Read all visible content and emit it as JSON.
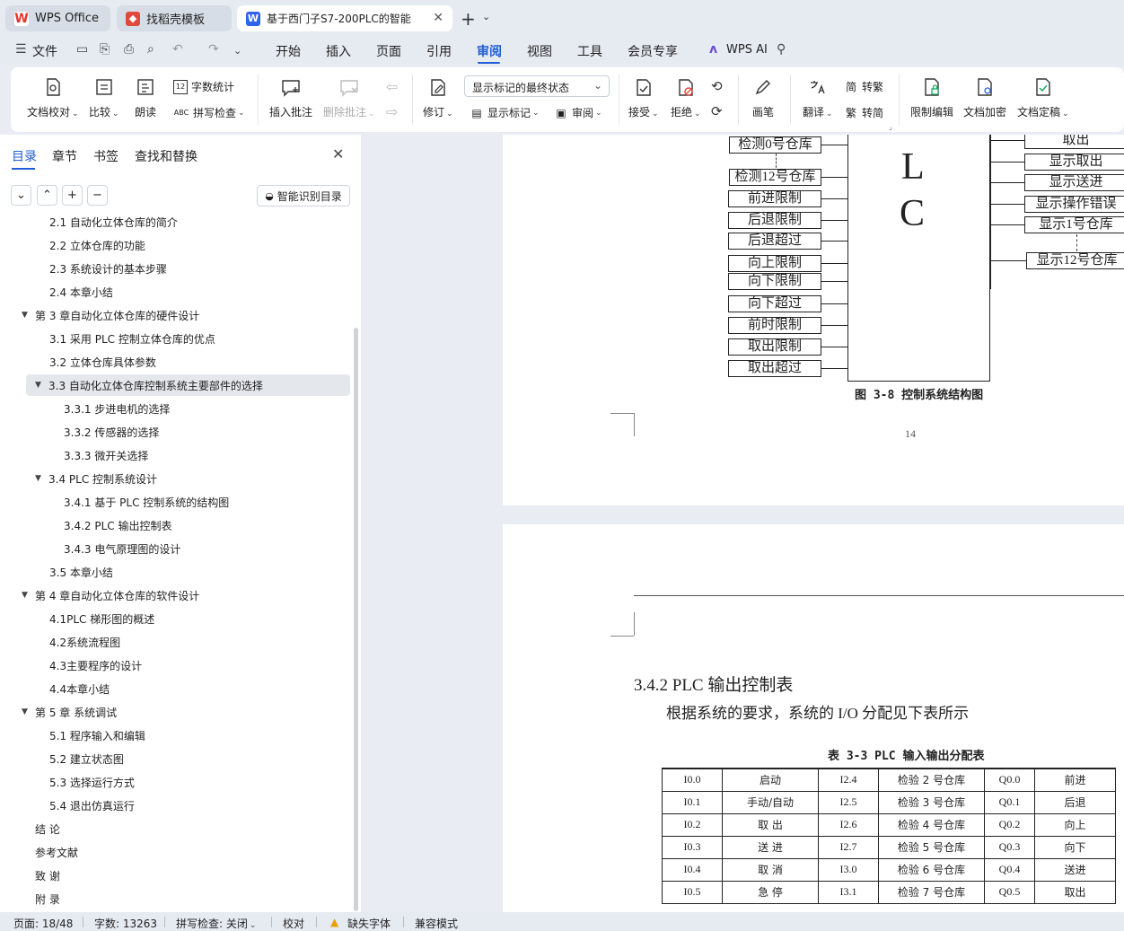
{
  "tabs": [
    {
      "label": "WPS Office",
      "icon": "wps-logo-icon"
    },
    {
      "label": "找稻壳模板",
      "icon": "docer-icon"
    },
    {
      "label": "基于西门子S7-200PLC的智能",
      "icon": "word-doc-icon",
      "active": true
    }
  ],
  "menu": {
    "file": "文件",
    "items": [
      "开始",
      "插入",
      "页面",
      "引用",
      "审阅",
      "视图",
      "工具",
      "会员专享"
    ],
    "active": "审阅",
    "wps_ai": "WPS AI"
  },
  "ribbon": {
    "doc_check": "文档校对",
    "compare": "比较",
    "read_aloud": "朗读",
    "word_count": "字数统计",
    "spell_check": "拼写检查",
    "insert_comment": "插入批注",
    "delete_comment": "删除批注",
    "track_changes": "修订",
    "markup_state": "显示标记的最终状态",
    "show_markup": "显示标记",
    "review": "审阅",
    "accept": "接受",
    "reject": "拒绝",
    "pen": "画笔",
    "translate": "翻译",
    "to_traditional": "转繁",
    "to_simplified": "转简",
    "restrict_edit": "限制编辑",
    "encrypt": "文档加密",
    "finalize": "文档定稿"
  },
  "panel": {
    "tabs": [
      "目录",
      "章节",
      "书签",
      "查找和替换"
    ],
    "smart_toc": "智能识别目录",
    "toc": [
      {
        "text": "2.1 自动化立体仓库的简介",
        "level": 2
      },
      {
        "text": "2.2 立体仓库的功能",
        "level": 2
      },
      {
        "text": "2.3 系统设计的基本步骤",
        "level": 2
      },
      {
        "text": "2.4 本章小结",
        "level": 2
      },
      {
        "text": "第 3 章自动化立体仓库的硬件设计",
        "level": 1,
        "expanded": true
      },
      {
        "text": "3.1  采用 PLC 控制立体仓库的优点",
        "level": 2
      },
      {
        "text": "3.2  立体仓库具体参数",
        "level": 2
      },
      {
        "text": "3.3  自动化立体仓库控制系统主要部件的选择",
        "level": 2,
        "expanded": true,
        "selected": true
      },
      {
        "text": "3.3.1 步进电机的选择",
        "level": 3
      },
      {
        "text": "3.3.2  传感器的选择",
        "level": 3
      },
      {
        "text": "3.3.3  微开关选择",
        "level": 3
      },
      {
        "text": "3.4 PLC 控制系统设计",
        "level": 2,
        "expanded": true
      },
      {
        "text": "3.4.1  基于 PLC 控制系统的结构图",
        "level": 3
      },
      {
        "text": "3.4.2 PLC 输出控制表",
        "level": 3
      },
      {
        "text": "3.4.3  电气原理图的设计",
        "level": 3
      },
      {
        "text": "3.5  本章小结",
        "level": 2
      },
      {
        "text": "第 4 章自动化立体仓库的软件设计",
        "level": 1,
        "expanded": true
      },
      {
        "text": "4.1PLC 梯形图的概述",
        "level": 2
      },
      {
        "text": "4.2系统流程图",
        "level": 2
      },
      {
        "text": "4.3主要程序的设计",
        "level": 2
      },
      {
        "text": "4.4本章小结",
        "level": 2
      },
      {
        "text": "第 5 章  系统调试",
        "level": 1,
        "expanded": true
      },
      {
        "text": "5.1  程序输入和编辑",
        "level": 2
      },
      {
        "text": "5.2  建立状态图",
        "level": 2
      },
      {
        "text": "5.3  选择运行方式",
        "level": 2
      },
      {
        "text": "5.4  退出仿真运行",
        "level": 2
      },
      {
        "text": "结  论",
        "level": 1
      },
      {
        "text": "参考文献",
        "level": 1
      },
      {
        "text": "致  谢",
        "level": 1
      },
      {
        "text": "附  录",
        "level": 1
      }
    ]
  },
  "doc": {
    "plc_letters": [
      "L",
      "C"
    ],
    "inputs": [
      "检测0号仓库",
      "检测12号仓库",
      "前进限制",
      "后退限制",
      "后退超过",
      "向上限制",
      "向下限制",
      "向下超过",
      "前时限制",
      "取出限制",
      "取出超过"
    ],
    "outputs": [
      "取出",
      "显示取出",
      "显示送进",
      "显示操作错误",
      "显示1号仓库",
      "显示12号仓库"
    ],
    "figure_caption": "图 3-8  控制系统结构图",
    "page_number": "14",
    "section_heading": "3.4.2 PLC 输出控制表",
    "intro_text": "根据系统的要求，系统的 I/O 分配见下表所示",
    "table_caption": "表 3-3  PLC 输入输出分配表",
    "table_rows": [
      [
        "I0.0",
        "启动",
        "I2.4",
        "检验 2 号仓库",
        "Q0.0",
        "前进"
      ],
      [
        "I0.1",
        "手动/自动",
        "I2.5",
        "检验 3 号仓库",
        "Q0.1",
        "后退"
      ],
      [
        "I0.2",
        "取      出",
        "I2.6",
        "检验 4 号仓库",
        "Q0.2",
        "向上"
      ],
      [
        "I0.3",
        "送      进",
        "I2.7",
        "检验 5 号仓库",
        "Q0.3",
        "向下"
      ],
      [
        "I0.4",
        "取      消",
        "I3.0",
        "检验 6 号仓库",
        "Q0.4",
        "送进"
      ],
      [
        "I0.5",
        "急      停",
        "I3.1",
        "检验 7 号仓库",
        "Q0.5",
        "取出"
      ]
    ]
  },
  "status": {
    "page": "页面: 18/48",
    "words": "字数: 13263",
    "spell": "拼写检查: 关闭",
    "proof": "校对",
    "missing_font": "缺失字体",
    "compat": "兼容模式"
  },
  "colors": {
    "accent": "#1f5dd8",
    "wps_red": "#e8342f",
    "docer_red": "#e04a3c",
    "doc_blue": "#2f64e8"
  }
}
